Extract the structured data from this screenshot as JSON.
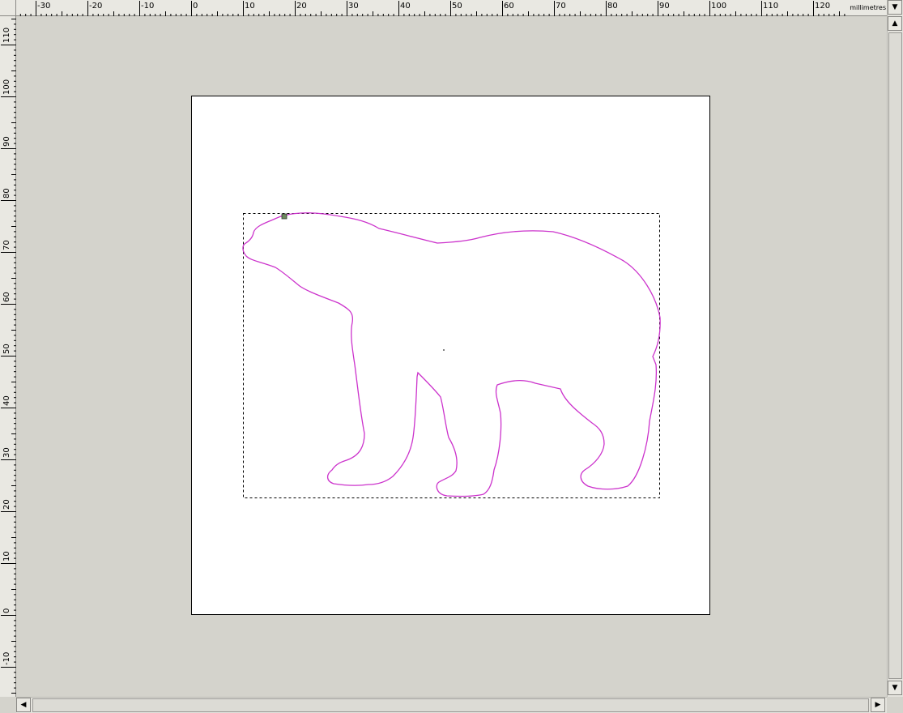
{
  "ruler": {
    "units": "millimetres",
    "h_ticks": [
      "-30",
      "-20",
      "-10",
      "0",
      "10",
      "20",
      "30",
      "40",
      "50",
      "60",
      "70",
      "80",
      "90",
      "100",
      "110",
      "120"
    ],
    "v_ticks": [
      "110",
      "100",
      "90",
      "80",
      "70",
      "60",
      "50",
      "40",
      "30",
      "20",
      "10",
      "0",
      "-10"
    ]
  },
  "document": {
    "shape_name": "polar-bear-outline",
    "stroke_color": "#cc33cc",
    "page_color": "#ffffff",
    "selection": "dashed-bounding-box"
  },
  "scrollbars": {
    "up_arrow": "▲",
    "down_arrow": "▼",
    "left_arrow": "◀",
    "right_arrow": "▶",
    "menu_arrow": "▼"
  }
}
